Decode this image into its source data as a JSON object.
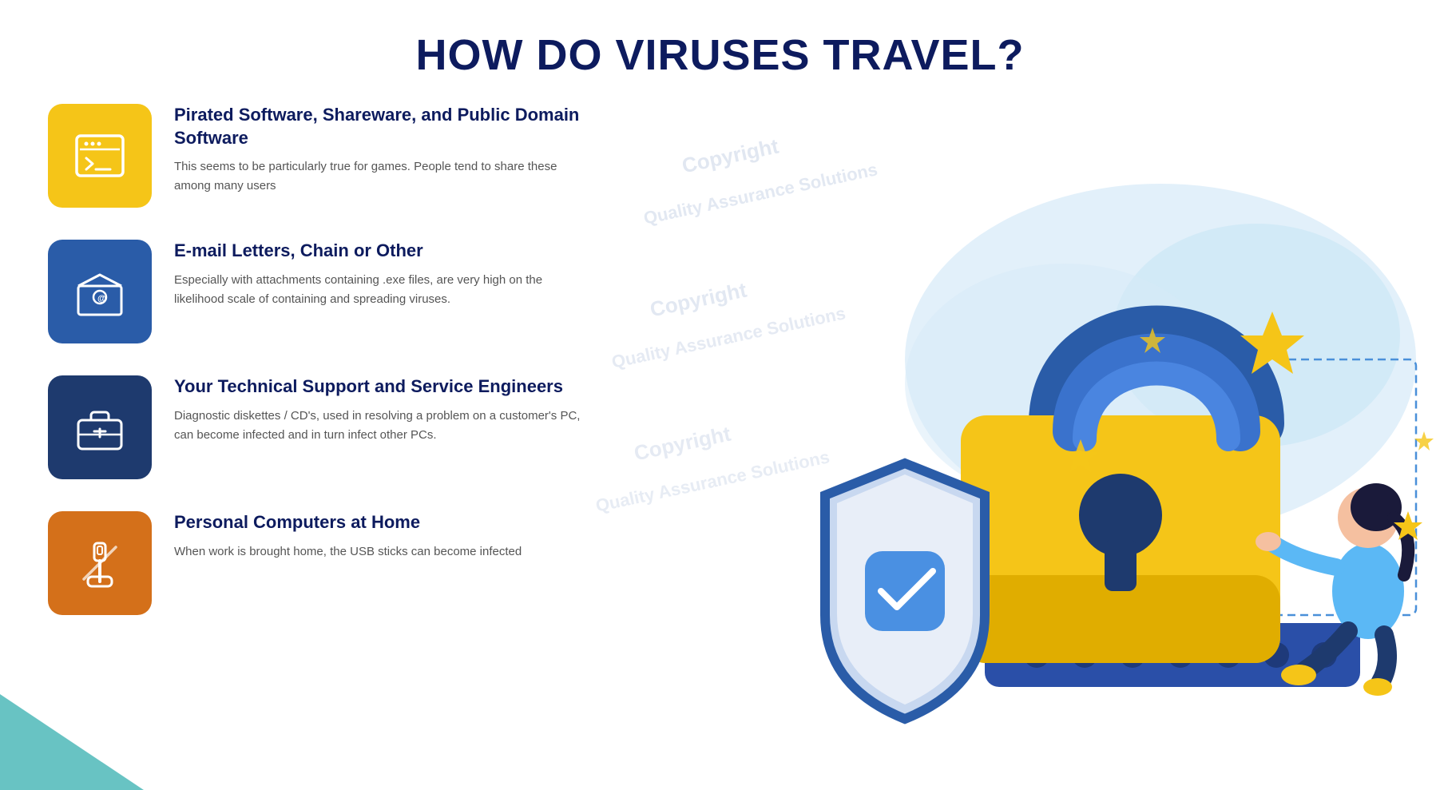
{
  "page": {
    "title": "HOW DO VIRUSES TRAVEL?"
  },
  "items": [
    {
      "id": "pirated-software",
      "icon_color": "yellow",
      "icon_type": "terminal",
      "title": "Pirated Software, Shareware, and Public Domain Software",
      "description": "This seems to be particularly true for games. People tend to share these among many users"
    },
    {
      "id": "email-letters",
      "icon_color": "blue",
      "icon_type": "email",
      "title": "E-mail Letters, Chain or Other",
      "description": "Especially with attachments containing .exe files, are very high on the likelihood scale of containing and spreading viruses."
    },
    {
      "id": "tech-support",
      "icon_color": "darkblue",
      "icon_type": "briefcase",
      "title": "Your Technical Support and Service Engineers",
      "description": "Diagnostic diskettes / CD's, used in resolving a problem on a customer's PC, can become infected and in turn infect other PCs."
    },
    {
      "id": "personal-computers",
      "icon_color": "orange",
      "icon_type": "usb",
      "title": "Personal Computers at Home",
      "description": "When work is brought home, the USB sticks can become infected"
    }
  ],
  "watermarks": [
    "Copyright",
    "Quality Assurance Solutions",
    "Copyright",
    "Quality Assurance Solutions",
    "Copyright",
    "Quality Assurance Solutions"
  ]
}
